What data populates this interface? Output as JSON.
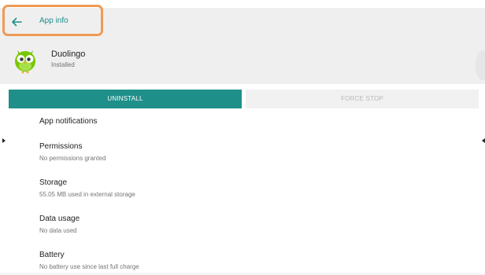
{
  "toolbar": {
    "title": "App info",
    "back_icon": "arrow-back-icon",
    "accent_color": "#1a8f8a"
  },
  "app": {
    "name": "Duolingo",
    "status": "Installed",
    "icon": "duolingo-owl-icon"
  },
  "buttons": {
    "uninstall": "UNINSTALL",
    "force_stop": "FORCE STOP",
    "uninstall_color": "#1f8f89"
  },
  "settings": [
    {
      "title": "App notifications",
      "summary": ""
    },
    {
      "title": "Permissions",
      "summary": "No permissions granted"
    },
    {
      "title": "Storage",
      "summary": "55.05 MB used in external storage"
    },
    {
      "title": "Data usage",
      "summary": "No data used"
    },
    {
      "title": "Battery",
      "summary": "No battery use since last full charge"
    }
  ],
  "highlight_color": "#ef9a55"
}
